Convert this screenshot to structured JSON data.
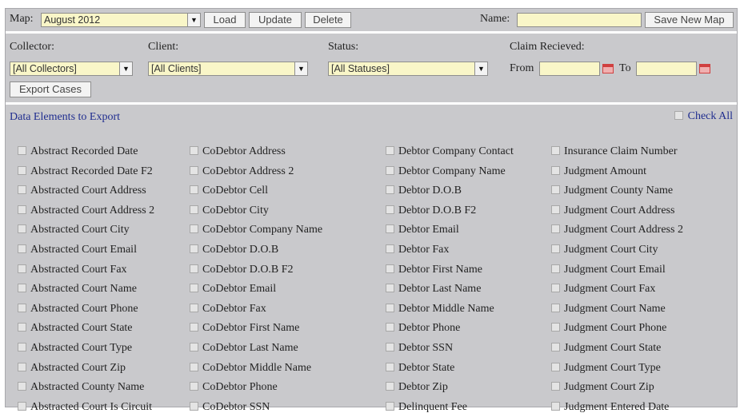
{
  "toolbar": {
    "map_label": "Map:",
    "map_value": "August 2012",
    "load_label": "Load",
    "update_label": "Update",
    "delete_label": "Delete",
    "name_label": "Name:",
    "name_value": "",
    "save_label": "Save New Map"
  },
  "filters": {
    "collector_label": "Collector:",
    "collector_value": "[All Collectors]",
    "client_label": "Client:",
    "client_value": "[All Clients]",
    "status_label": "Status:",
    "status_value": "[All Statuses]",
    "claim_label": "Claim Recieved:",
    "from_label": "From",
    "from_value": "",
    "to_label": "To",
    "to_value": "",
    "export_label": "Export Cases"
  },
  "elements": {
    "title": "Data Elements to Export",
    "check_all_label": "Check All",
    "columns": [
      [
        "Abstract Recorded Date",
        "Abstract Recorded Date F2",
        "Abstracted Court Address",
        "Abstracted Court Address 2",
        "Abstracted Court City",
        "Abstracted Court Email",
        "Abstracted Court Fax",
        "Abstracted Court Name",
        "Abstracted Court Phone",
        "Abstracted Court State",
        "Abstracted Court Type",
        "Abstracted Court Zip",
        "Abstracted County Name",
        "Abstracted Court Is Circuit"
      ],
      [
        "CoDebtor Address",
        "CoDebtor Address 2",
        "CoDebtor Cell",
        "CoDebtor City",
        "CoDebtor Company Name",
        "CoDebtor D.O.B",
        "CoDebtor D.O.B F2",
        "CoDebtor Email",
        "CoDebtor Fax",
        "CoDebtor First Name",
        "CoDebtor Last Name",
        "CoDebtor Middle Name",
        "CoDebtor Phone",
        "CoDebtor SSN"
      ],
      [
        "Debtor Company Contact",
        "Debtor Company Name",
        "Debtor D.O.B",
        "Debtor D.O.B F2",
        "Debtor Email",
        "Debtor Fax",
        "Debtor First Name",
        "Debtor Last Name",
        "Debtor Middle Name",
        "Debtor Phone",
        "Debtor SSN",
        "Debtor State",
        "Debtor Zip",
        "Delinquent Fee"
      ],
      [
        "Insurance Claim Number",
        "Judgment Amount",
        "Judgment County Name",
        "Judgment Court Address",
        "Judgment Court Address 2",
        "Judgment Court City",
        "Judgment Court Email",
        "Judgment Court Fax",
        "Judgment Court Name",
        "Judgment Court Phone",
        "Judgment Court State",
        "Judgment Court Type",
        "Judgment Court Zip",
        "Judgment Entered Date"
      ]
    ]
  }
}
